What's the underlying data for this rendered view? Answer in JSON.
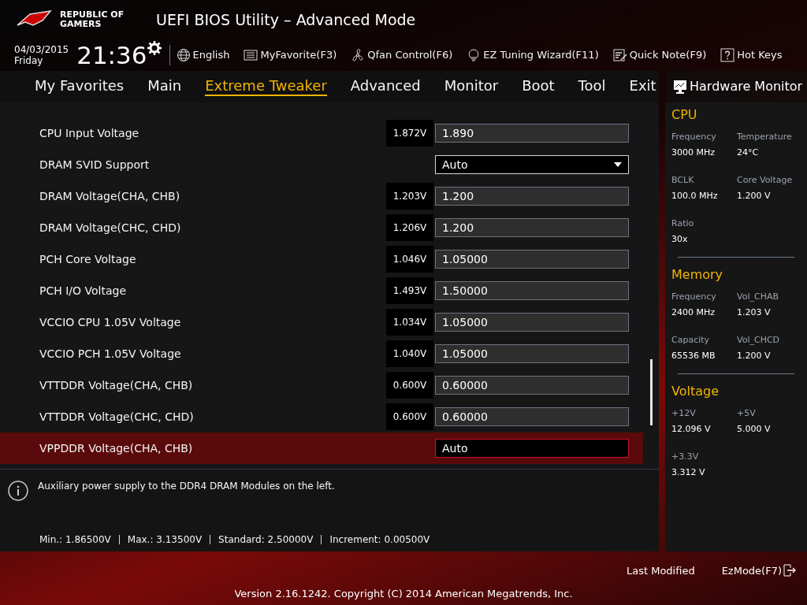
{
  "header": {
    "logo_text": "REPUBLIC OF GAMERS",
    "title": "UEFI BIOS Utility – Advanced Mode"
  },
  "toolbar": {
    "date": "04/03/2015",
    "day": "Friday",
    "time": "21:36",
    "items": [
      {
        "kind": "globe",
        "label": "English"
      },
      {
        "kind": "favorite",
        "label": "MyFavorite(F3)"
      },
      {
        "kind": "fan",
        "label": "Qfan Control(F6)"
      },
      {
        "kind": "bulb",
        "label": "EZ Tuning Wizard(F11)"
      },
      {
        "kind": "note",
        "label": "Quick Note(F9)"
      },
      {
        "kind": "help",
        "label": "Hot Keys"
      }
    ]
  },
  "tabs": [
    {
      "label": "My Favorites",
      "selected": false
    },
    {
      "label": "Main",
      "selected": false
    },
    {
      "label": "Extreme Tweaker",
      "selected": true
    },
    {
      "label": "Advanced",
      "selected": false
    },
    {
      "label": "Monitor",
      "selected": false
    },
    {
      "label": "Boot",
      "selected": false
    },
    {
      "label": "Tool",
      "selected": false
    },
    {
      "label": "Exit",
      "selected": false
    }
  ],
  "settings": [
    {
      "kind": "readout",
      "label": "CPU Input Voltage",
      "reading": "1.872V",
      "value": "1.890",
      "selected": false
    },
    {
      "kind": "dropdown",
      "label": "DRAM SVID Support",
      "value": "Auto",
      "selected": false
    },
    {
      "kind": "readout",
      "label": "DRAM Voltage(CHA, CHB)",
      "reading": "1.203V",
      "value": "1.200",
      "selected": false
    },
    {
      "kind": "readout",
      "label": "DRAM Voltage(CHC, CHD)",
      "reading": "1.206V",
      "value": "1.200",
      "selected": false
    },
    {
      "kind": "readout",
      "label": "PCH Core Voltage",
      "reading": "1.046V",
      "value": "1.05000",
      "selected": false
    },
    {
      "kind": "readout",
      "label": "PCH I/O Voltage",
      "reading": "1.493V",
      "value": "1.50000",
      "selected": false
    },
    {
      "kind": "readout",
      "label": "VCCIO CPU 1.05V Voltage",
      "reading": "1.034V",
      "value": "1.05000",
      "selected": false
    },
    {
      "kind": "readout",
      "label": "VCCIO PCH 1.05V Voltage",
      "reading": "1.040V",
      "value": "1.05000",
      "selected": false
    },
    {
      "kind": "readout",
      "label": "VTTDDR Voltage(CHA, CHB)",
      "reading": "0.600V",
      "value": "0.60000",
      "selected": false
    },
    {
      "kind": "readout",
      "label": "VTTDDR Voltage(CHC, CHD)",
      "reading": "0.600V",
      "value": "0.60000",
      "selected": false
    },
    {
      "kind": "field",
      "label": "VPPDDR Voltage(CHA, CHB)",
      "value": "Auto",
      "selected": true
    }
  ],
  "help": {
    "text": "Auxiliary power supply to the DDR4 DRAM Modules on the left.",
    "limits": [
      "Min.: 1.86500V",
      "Max.: 3.13500V",
      "Standard: 2.50000V",
      "Increment: 0.00500V"
    ]
  },
  "hardware_monitor": {
    "title": "Hardware Monitor",
    "sections": [
      {
        "title": "CPU",
        "items": [
          {
            "label": "Frequency",
            "value": "3000 MHz"
          },
          {
            "label": "Temperature",
            "value": "24°C"
          },
          {
            "label": "BCLK",
            "value": "100.0 MHz"
          },
          {
            "label": "Core Voltage",
            "value": "1.200 V"
          },
          {
            "label": "Ratio",
            "value": "30x"
          }
        ]
      },
      {
        "title": "Memory",
        "items": [
          {
            "label": "Frequency",
            "value": "2400 MHz"
          },
          {
            "label": "Vol_CHAB",
            "value": "1.203 V"
          },
          {
            "label": "Capacity",
            "value": "65536 MB"
          },
          {
            "label": "Vol_CHCD",
            "value": "1.200 V"
          }
        ]
      },
      {
        "title": "Voltage",
        "items": [
          {
            "label": "+12V",
            "value": "12.096 V"
          },
          {
            "label": "+5V",
            "value": "5.000 V"
          },
          {
            "label": "+3.3V",
            "value": "3.312 V"
          }
        ]
      }
    ]
  },
  "footer": {
    "last_modified": "Last Modified",
    "ezmode": "EzMode(F7)",
    "version": "Version 2.16.1242. Copyright (C) 2014 American Megatrends, Inc."
  }
}
